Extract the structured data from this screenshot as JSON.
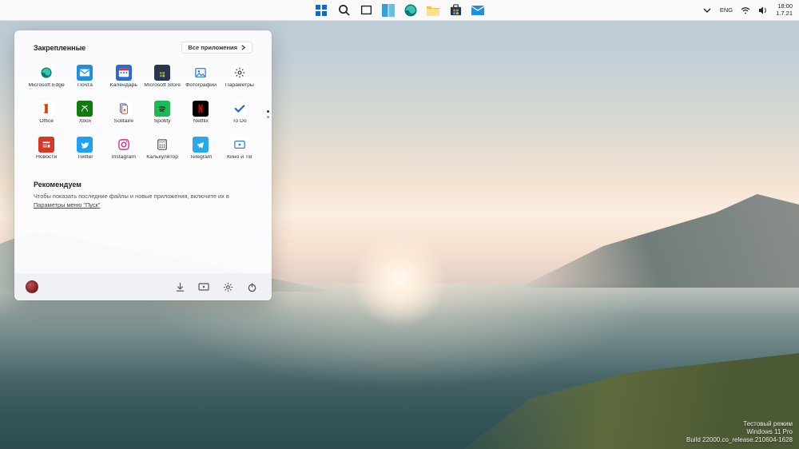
{
  "taskbar": {
    "center_items": [
      {
        "name": "start-icon",
        "title": "Пуск"
      },
      {
        "name": "search-icon",
        "title": "Поиск"
      },
      {
        "name": "taskview-icon",
        "title": "Task View"
      },
      {
        "name": "widgets-icon",
        "title": "Виджеты"
      },
      {
        "name": "edge-icon",
        "title": "Microsoft Edge"
      },
      {
        "name": "explorer-icon",
        "title": "Проводник"
      },
      {
        "name": "store-icon",
        "title": "Microsoft Store"
      },
      {
        "name": "mail-icon",
        "title": "Почта"
      }
    ],
    "tray": {
      "chevron": "chevron-up-icon",
      "lang": "ENG",
      "wifi": "wifi-icon",
      "sound": "sound-icon",
      "time": "18:00",
      "date": "1.7.21"
    }
  },
  "startmenu": {
    "pinned_label": "Закрепленные",
    "all_apps_label": "Все приложения",
    "apps": [
      {
        "label": "Microsoft Edge",
        "icon": "edge",
        "bg": "#ffffff",
        "clr": "#0a7a6e"
      },
      {
        "label": "Почта",
        "icon": "mail",
        "bg": "#1f8fe0",
        "clr": "#ffffff"
      },
      {
        "label": "Календарь",
        "icon": "calendar",
        "bg": "#2b6bd1",
        "clr": "#ffffff"
      },
      {
        "label": "Microsoft Store",
        "icon": "store",
        "bg": "#27364f",
        "clr": "#ffffff"
      },
      {
        "label": "Фотографии",
        "icon": "photos",
        "bg": "#ffffff",
        "clr": "#2b7bd6"
      },
      {
        "label": "Параметры",
        "icon": "settings",
        "bg": "#ffffff",
        "clr": "#3a3a3a"
      },
      {
        "label": "Office",
        "icon": "office",
        "bg": "#ffffff",
        "clr": "#d83b01"
      },
      {
        "label": "Xbox",
        "icon": "xbox",
        "bg": "#107c10",
        "clr": "#ffffff"
      },
      {
        "label": "Solitaire",
        "icon": "solitaire",
        "bg": "#ffffff",
        "clr": "#0055aa"
      },
      {
        "label": "Spotify",
        "icon": "spotify",
        "bg": "#1db954",
        "clr": "#ffffff"
      },
      {
        "label": "Netflix",
        "icon": "netflix",
        "bg": "#000000",
        "clr": "#e50914"
      },
      {
        "label": "To Do",
        "icon": "todo",
        "bg": "#ffffff",
        "clr": "#2564cf"
      },
      {
        "label": "Новости",
        "icon": "news",
        "bg": "#d33828",
        "clr": "#ffffff"
      },
      {
        "label": "Twitter",
        "icon": "twitter",
        "bg": "#1da1f2",
        "clr": "#ffffff"
      },
      {
        "label": "Instagram",
        "icon": "instagram",
        "bg": "#ffffff",
        "clr": "#d62e86"
      },
      {
        "label": "Калькулятор",
        "icon": "calculator",
        "bg": "#ffffff",
        "clr": "#3a3a3a"
      },
      {
        "label": "Telegram",
        "icon": "telegram",
        "bg": "#29a9ea",
        "clr": "#ffffff"
      },
      {
        "label": "Кино и ТВ",
        "icon": "video",
        "bg": "#ffffff",
        "clr": "#2b7bd6"
      }
    ],
    "recommended_label": "Рекомендуем",
    "recommended_text": "Чтобы показать последние файлы и новые приложения, включите их в ",
    "recommended_link": "Параметры меню \"Пуск\"",
    "footer_icons": [
      {
        "name": "downloads-icon"
      },
      {
        "name": "cast-icon"
      },
      {
        "name": "settings-icon"
      },
      {
        "name": "power-icon"
      }
    ]
  },
  "watermark": {
    "line1": "Тестовый режим",
    "line2": "Windows 11 Pro",
    "line3": "Build 22000.co_release.210604-1628"
  }
}
